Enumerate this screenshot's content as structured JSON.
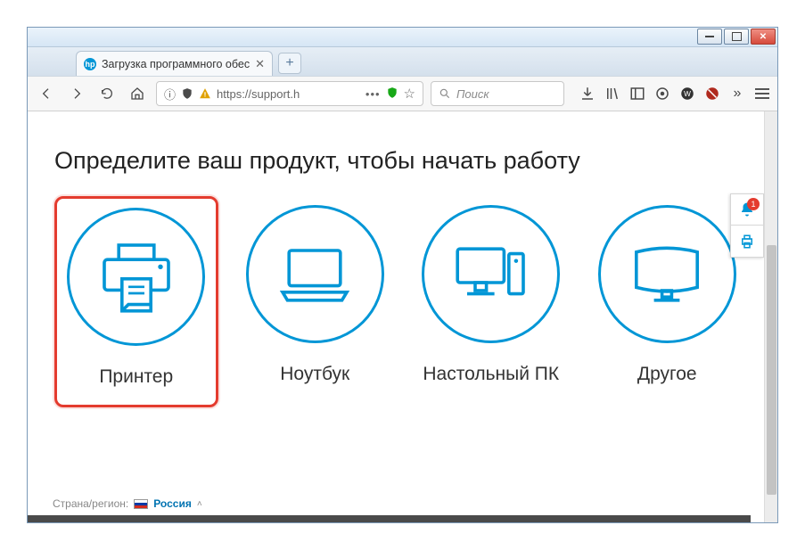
{
  "tab": {
    "title": "Загрузка программного обес"
  },
  "url": {
    "info": "ⓘ",
    "shield_label": "tracking-protection",
    "address": "https://support.h",
    "dots": "•••"
  },
  "search": {
    "placeholder": "Поиск"
  },
  "page": {
    "heading": "Определите ваш продукт, чтобы начать работу",
    "products": [
      {
        "label": "Принтер"
      },
      {
        "label": "Ноутбук"
      },
      {
        "label": "Настольный ПК"
      },
      {
        "label": "Другое"
      }
    ]
  },
  "region": {
    "prefix": "Страна/регион:",
    "name": "Россия"
  },
  "notifications": {
    "count": "1"
  },
  "colors": {
    "hp_blue": "#0096d6",
    "highlight_red": "#e43b2e"
  }
}
